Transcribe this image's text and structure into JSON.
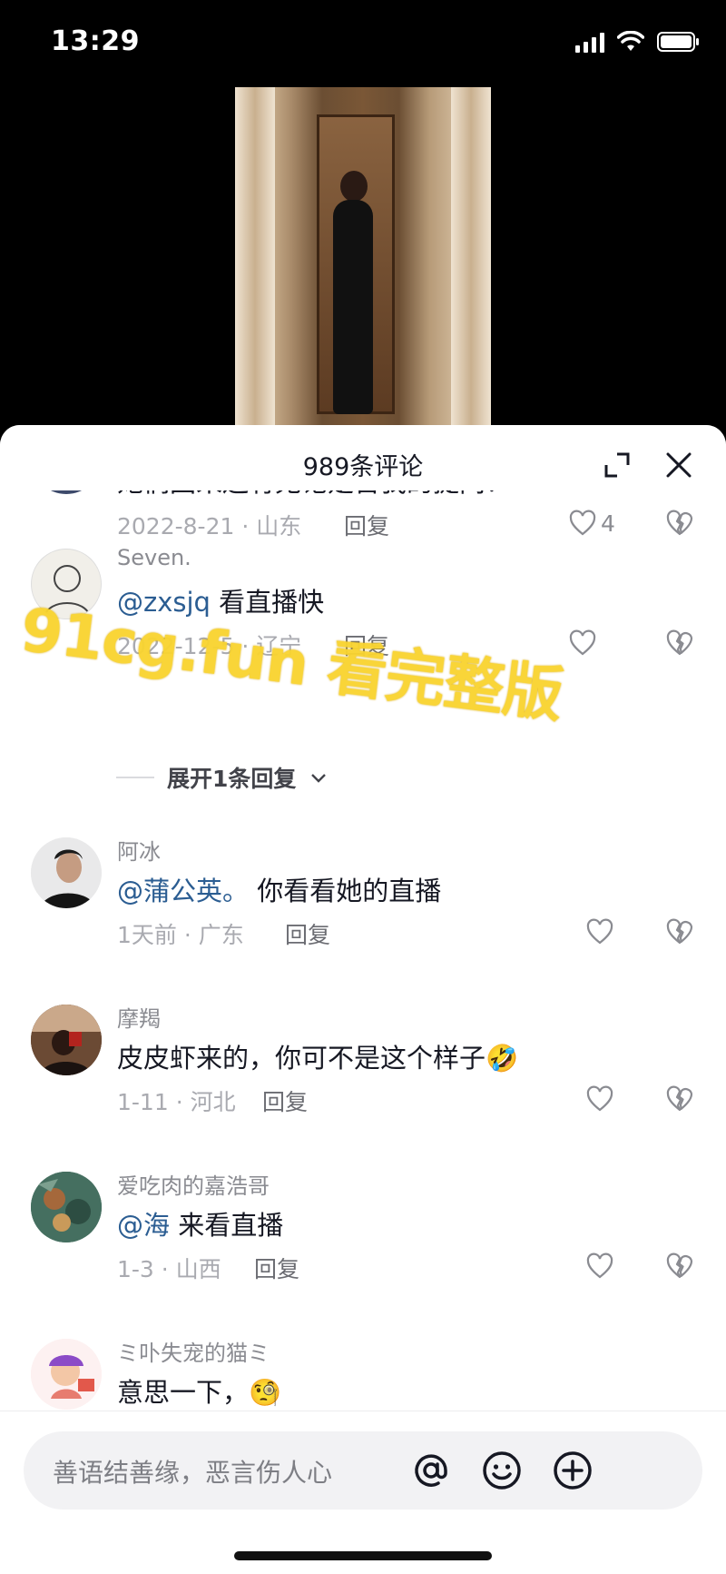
{
  "status": {
    "time": "13:29"
  },
  "sheet": {
    "title": "989条评论"
  },
  "comments": [
    {
      "partial_text": "她们回来还有无论是否我的提问？",
      "date": "2022-8-21",
      "location": "山东",
      "reply": "回复",
      "likes": "4"
    },
    {
      "name": "Seven.",
      "mention": "@zxsjq",
      "text": " 看直播快",
      "date": "2022-12-5",
      "location": "辽宁",
      "reply": "回复"
    },
    {
      "name": "阿冰",
      "mention": "@蒲公英。",
      "text": " 你看看她的直播",
      "date": "1天前",
      "location": "广东",
      "reply": "回复"
    },
    {
      "name": "摩羯",
      "text": "皮皮虾来的，你可不是这个样子",
      "emoji": "🤣",
      "date": "1-11",
      "location": "河北",
      "reply": "回复"
    },
    {
      "name": "爱吃肉的嘉浩哥",
      "mention": "@海",
      "text": " 来看直播",
      "date": "1-3",
      "location": "山西",
      "reply": "回复"
    },
    {
      "name": "ミ卟失宠的猫ミ",
      "text": "意思一下，",
      "emoji": "🧐"
    }
  ],
  "expand_replies": "展开1条回复",
  "watermark": "91cg.fun 看完整版",
  "input": {
    "placeholder": "善语结善缘，恶言伤人心"
  },
  "icons": {
    "expand": "expand-icon",
    "close": "close-icon",
    "like": "heart-icon",
    "dislike": "broken-heart-icon",
    "at": "at-icon",
    "emoji": "emoji-icon",
    "add": "plus-icon"
  },
  "colors": {
    "mention": "#2b5d92",
    "watermark": "#f9d430"
  }
}
